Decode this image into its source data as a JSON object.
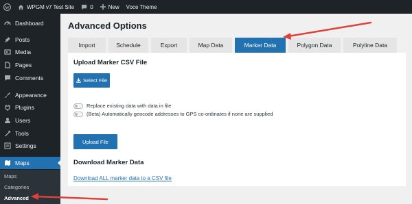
{
  "admin_bar": {
    "site_name": "WPGM v7 Test Site",
    "comments_count": "0",
    "new_label": "New",
    "theme_label": "Voce Theme"
  },
  "sidebar": {
    "items": [
      {
        "label": "Dashboard",
        "icon": "dashboard-icon"
      },
      {
        "label": "Posts",
        "icon": "pin-icon"
      },
      {
        "label": "Media",
        "icon": "media-icon"
      },
      {
        "label": "Pages",
        "icon": "page-icon"
      },
      {
        "label": "Comments",
        "icon": "comment-icon"
      },
      {
        "label": "Appearance",
        "icon": "brush-icon"
      },
      {
        "label": "Plugins",
        "icon": "plugin-icon"
      },
      {
        "label": "Users",
        "icon": "user-icon"
      },
      {
        "label": "Tools",
        "icon": "wrench-icon"
      },
      {
        "label": "Settings",
        "icon": "settings-icon"
      },
      {
        "label": "Maps",
        "icon": "map-icon",
        "active": true
      }
    ],
    "submenu": [
      "Maps",
      "Categories",
      "Advanced"
    ]
  },
  "page_title": "Advanced Options",
  "tabs": [
    "Import",
    "Schedule",
    "Export",
    "Map Data",
    "Marker Data",
    "Polygon Data",
    "Polyline Data"
  ],
  "active_tab": "Marker Data",
  "upload": {
    "heading": "Upload Marker CSV File",
    "select_button": "Select File",
    "options": [
      "Replace existing data with data in file",
      "(Beta) Automatically geocode addresses to GPS co-ordinates if none are supplied"
    ],
    "upload_button": "Upload File"
  },
  "download": {
    "heading": "Download Marker Data",
    "link": "Download ALL marker data to a CSV file"
  },
  "colors": {
    "accent": "#2271b1",
    "sidebar_bg": "#1d2327",
    "annotation_arrow": "#e0403a"
  }
}
